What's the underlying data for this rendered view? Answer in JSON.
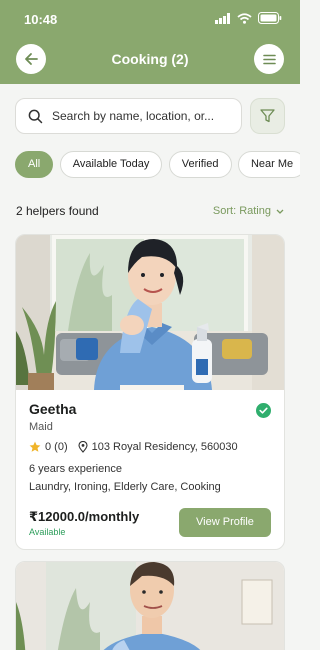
{
  "status_bar": {
    "time": "10:48"
  },
  "header": {
    "title": "Cooking (2)"
  },
  "search": {
    "placeholder": "Search by name, location, or..."
  },
  "filters": [
    "All",
    "Available Today",
    "Verified",
    "Near Me"
  ],
  "results": {
    "count_text": "2 helpers found",
    "sort_label": "Sort: Rating"
  },
  "helpers": [
    {
      "name": "Geetha",
      "role": "Maid",
      "rating": "0 (0)",
      "location": "103 Royal Residency, 560030",
      "experience": "6 years experience",
      "skills": "Laundry, Ironing, Elderly Care, Cooking",
      "price": "₹12000.0/monthly",
      "availability": "Available",
      "button": "View Profile",
      "verified": true
    }
  ],
  "colors": {
    "primary": "#8aa86e",
    "available": "#2d9d5b",
    "verified": "#2fae6d",
    "star": "#f0b429"
  }
}
